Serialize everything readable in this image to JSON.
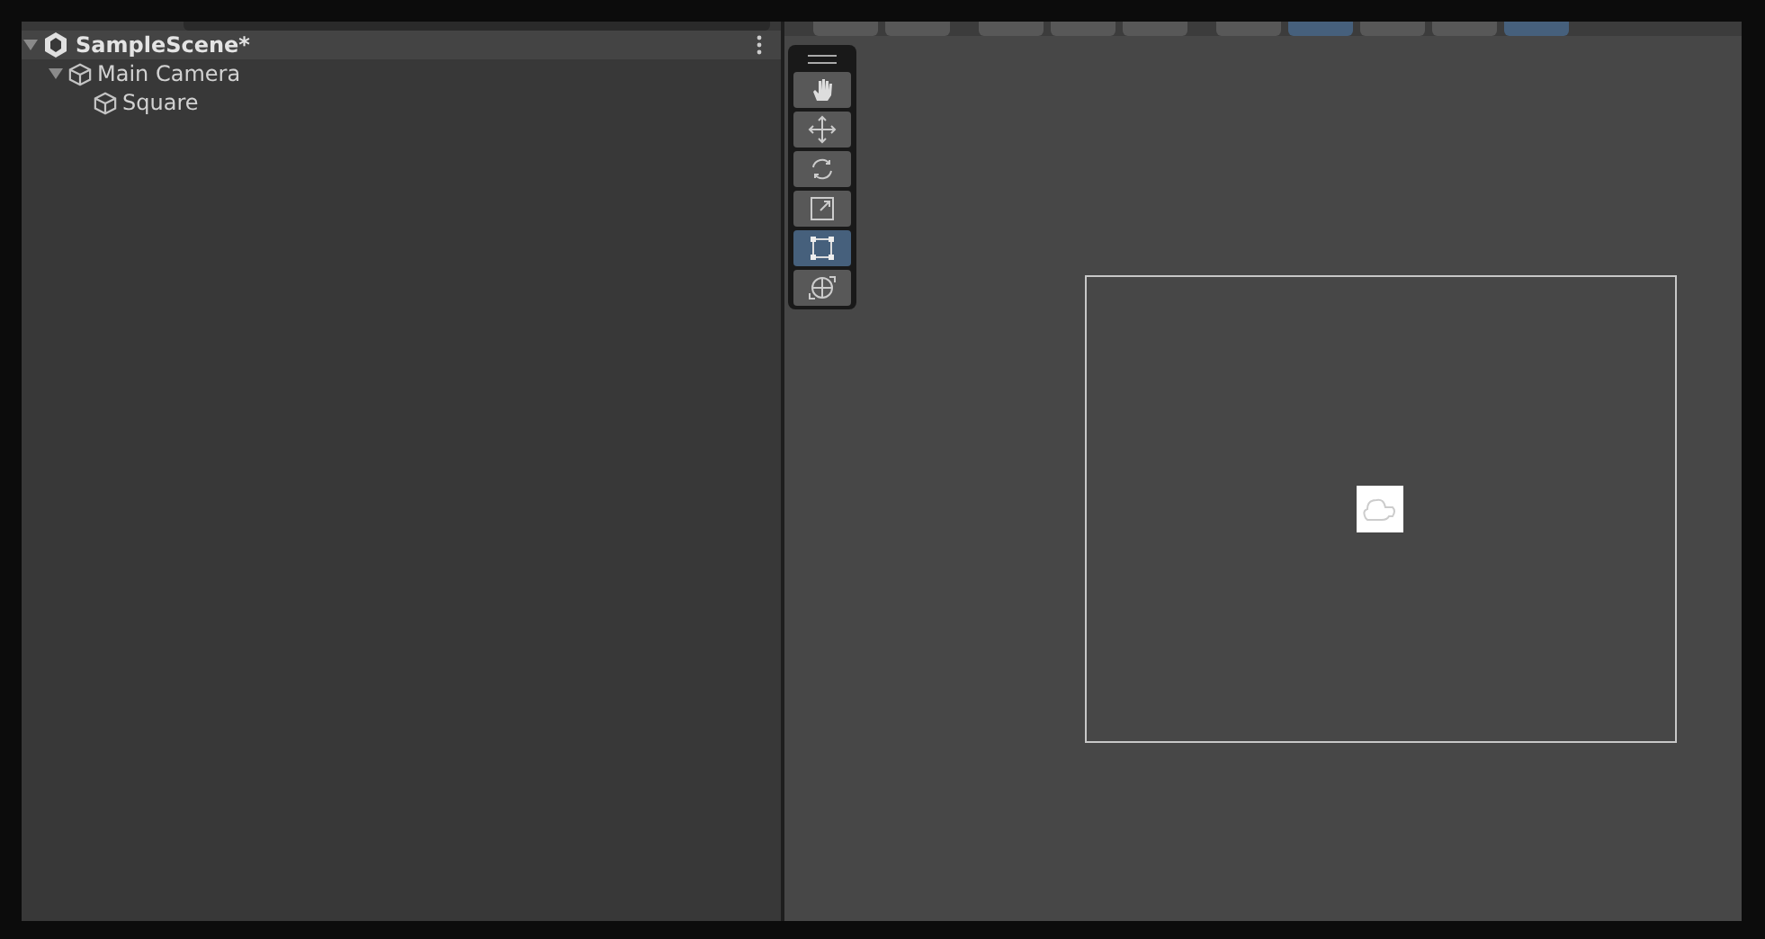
{
  "hierarchy": {
    "scene": {
      "name": "SampleScene*",
      "expanded": true
    },
    "items": [
      {
        "name": "Main Camera",
        "expanded": true,
        "children": [
          {
            "name": "Square"
          }
        ]
      }
    ]
  },
  "scene_view": {
    "toolbar_buttons": [
      {
        "selected": false
      },
      {
        "selected": false
      },
      {
        "selected": false
      },
      {
        "selected": false
      },
      {
        "selected": false
      },
      {
        "selected": false
      },
      {
        "selected": true
      },
      {
        "selected": false
      },
      {
        "selected": false
      },
      {
        "selected": true
      }
    ],
    "tools": [
      {
        "kind": "hand",
        "selected": false
      },
      {
        "kind": "move",
        "selected": false
      },
      {
        "kind": "rotate",
        "selected": false
      },
      {
        "kind": "scale",
        "selected": false
      },
      {
        "kind": "rect",
        "selected": true
      },
      {
        "kind": "transform",
        "selected": false
      }
    ]
  }
}
